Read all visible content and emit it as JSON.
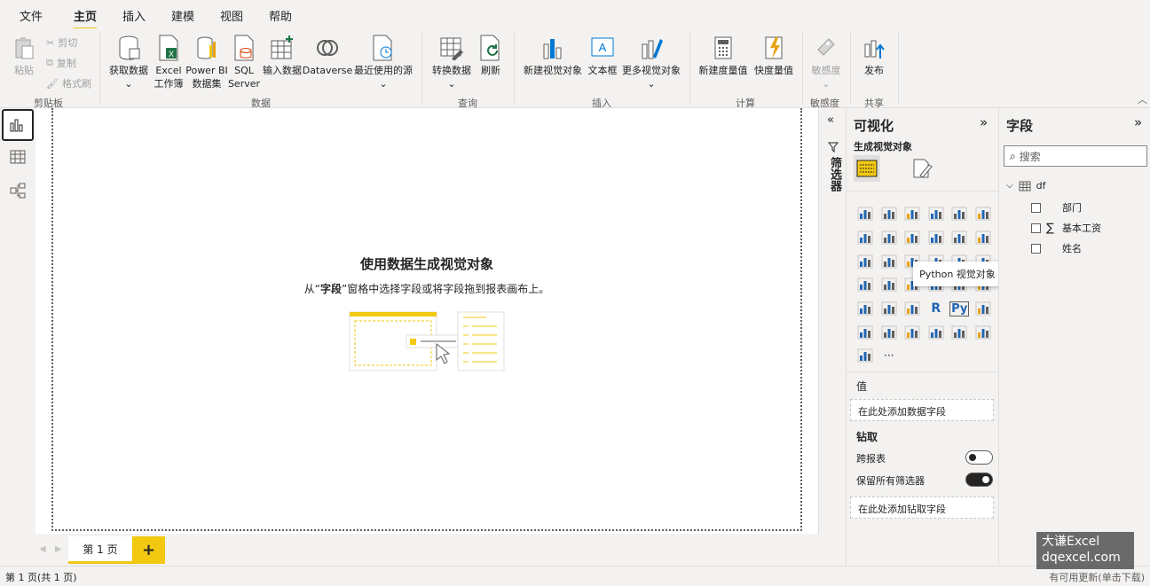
{
  "menu": {
    "tabs": [
      "文件",
      "主页",
      "插入",
      "建模",
      "视图",
      "帮助"
    ],
    "active": "主页"
  },
  "ribbon": {
    "clipboard": {
      "paste": "粘贴",
      "cut": "剪切",
      "copy": "复制",
      "format_painter": "格式刷",
      "group": "剪贴板"
    },
    "data": {
      "get_data": "获取数据",
      "excel_line1": "Excel",
      "excel_line2": "工作簿",
      "pbi_line1": "Power BI",
      "pbi_line2": "数据集",
      "sql_line1": "SQL",
      "sql_line2": "Server",
      "enter_data": "输入数据",
      "dataverse": "Dataverse",
      "recent": "最近使用的源",
      "group": "数据"
    },
    "query": {
      "transform": "转换数据",
      "refresh": "刷新",
      "group": "查询"
    },
    "insert": {
      "new_visual": "新建视觉对象",
      "textbox": "文本框",
      "more_visuals": "更多视觉对象",
      "group": "插入"
    },
    "calc": {
      "new_measure": "新建度量值",
      "quick_measure": "快度量值",
      "group": "计算"
    },
    "sensitivity": {
      "label": "敏感度",
      "group": "敏感度"
    },
    "share": {
      "publish": "发布",
      "group": "共享"
    }
  },
  "canvas": {
    "title": "使用数据生成视觉对象",
    "subtitle_pre": "从“",
    "subtitle_bold": "字段",
    "subtitle_post": "”窗格中选择字段或将字段拖到报表画布上。"
  },
  "pages": {
    "tab": "第 1 页",
    "add": "+"
  },
  "status": {
    "left": "第 1 页(共 1 页)",
    "right": "有可用更新(单击下载)"
  },
  "filters": {
    "label": "筛选器"
  },
  "viz": {
    "title": "可视化",
    "build": "生成视觉对象",
    "values_label": "值",
    "values_well": "在此处添加数据字段",
    "drill_label": "钻取",
    "cross_report": "跨报表",
    "keep_filters": "保留所有筛选器",
    "drill_well": "在此处添加钻取字段",
    "tooltip": "Python 视觉对象",
    "more": "···",
    "r_label": "R",
    "py_label": "Py"
  },
  "fields": {
    "title": "字段",
    "search_placeholder": "搜索",
    "table": "df",
    "items": [
      "部门",
      "基本工资",
      "姓名"
    ]
  },
  "watermark": {
    "line1": "大谦Excel",
    "line2": "dqexcel.com"
  }
}
